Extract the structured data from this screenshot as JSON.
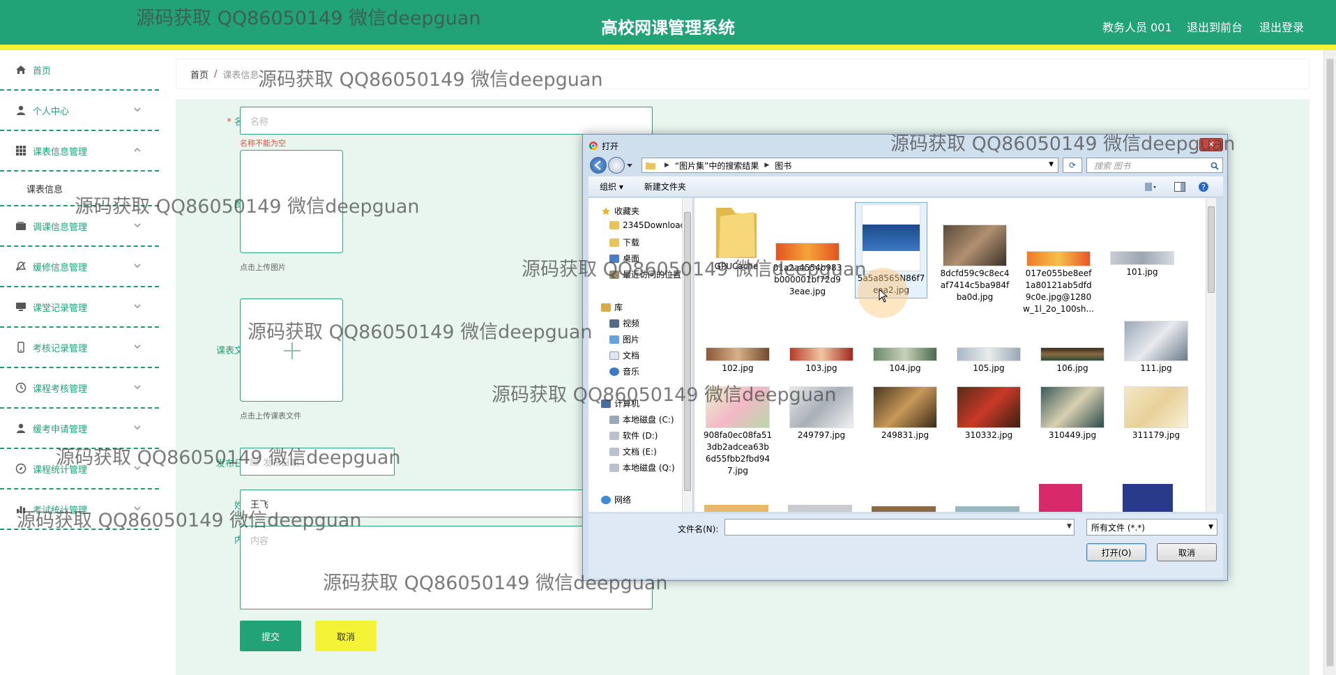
{
  "header": {
    "title": "高校网课管理系统",
    "user": "教务人员 001",
    "front_link": "退出到前台",
    "logout_link": "退出登录",
    "color": "#22a277",
    "accent": "#f5f335"
  },
  "sidebar": {
    "items": [
      {
        "label": "首页",
        "icon": "home-icon"
      },
      {
        "label": "个人中心",
        "icon": "user-icon"
      },
      {
        "label": "课表信息管理",
        "icon": "grid-icon"
      },
      {
        "label": "调课信息管理",
        "icon": "wallet-icon"
      },
      {
        "label": "缓修信息管理",
        "icon": "bell-off-icon"
      },
      {
        "label": "课堂记录管理",
        "icon": "monitor-icon"
      },
      {
        "label": "考核记录管理",
        "icon": "phone-icon"
      },
      {
        "label": "课程考核管理",
        "icon": "clock-icon"
      },
      {
        "label": "缓考申请管理",
        "icon": "user-icon"
      },
      {
        "label": "课程统计管理",
        "icon": "compass-icon"
      },
      {
        "label": "考试统计管理",
        "icon": "chart-icon"
      }
    ],
    "sub_item": "课表信息"
  },
  "breadcrumb": {
    "home": "首页",
    "sep": "/",
    "current": "课表信息"
  },
  "form": {
    "name_label": "名称",
    "name_placeholder": "名称",
    "name_error": "名称不能为空",
    "image_label": "图片",
    "image_hint": "点击上传图片",
    "file_label": "课表文件",
    "file_hint": "点击上传课表文件",
    "date_label": "发布日期",
    "date_placeholder": "发布日期",
    "teacher_label": "姓名",
    "teacher_value": "王飞",
    "content_label": "内容",
    "content_placeholder": "内容",
    "submit": "提交",
    "cancel": "取消"
  },
  "dialog": {
    "title": "打开",
    "close": "✕",
    "path": [
      "“图片集”中的搜索结果",
      "图书"
    ],
    "search_placeholder": "搜索 图书",
    "toolbar": {
      "organize": "组织 ▾",
      "new_folder": "新建文件夹"
    },
    "nav": {
      "favorites": "收藏夹",
      "favorites_items": [
        "2345Downloads",
        "下载",
        "桌面",
        "最近访问的位置"
      ],
      "libraries": "库",
      "library_items": [
        "视频",
        "图片",
        "文档",
        "音乐"
      ],
      "computer": "计算机",
      "drives": [
        "本地磁盘 (C:)",
        "软件 (D:)",
        "文档 (E:)",
        "本地磁盘 (Q:)"
      ],
      "network": "网络"
    },
    "files": [
      {
        "name": "GPUCache",
        "lines": [
          "GPUCache"
        ]
      },
      {
        "name": "01a2a4554b983b000001bf72d93eae.jpg",
        "lines": [
          "01a2a4554b983",
          "b000001bf72d9",
          "3eae.jpg"
        ]
      },
      {
        "name": "5a5a8565N86f7eaa2.jpg",
        "lines": [
          "5a5a8565N86f7",
          "eaa2.jpg"
        ]
      },
      {
        "name": "8dcfd59c9c8ec4af7414c5ba984fba0d.jpg",
        "lines": [
          "8dcfd59c9c8ec4",
          "af7414c5ba984f",
          "ba0d.jpg"
        ]
      },
      {
        "name": "017e055be8eef1a80121ab5dfd9c0e.jpg@1280w_1l_2o_100sh...",
        "lines": [
          "017e055be8eef",
          "1a80121ab5dfd",
          "9c0e.jpg@1280",
          "w_1l_2o_100sh..."
        ]
      },
      {
        "name": "101.jpg",
        "lines": [
          "101.jpg"
        ]
      },
      {
        "name": "102.jpg",
        "lines": [
          "102.jpg"
        ]
      },
      {
        "name": "103.jpg",
        "lines": [
          "103.jpg"
        ]
      },
      {
        "name": "104.jpg",
        "lines": [
          "104.jpg"
        ]
      },
      {
        "name": "105.jpg",
        "lines": [
          "105.jpg"
        ]
      },
      {
        "name": "106.jpg",
        "lines": [
          "106.jpg"
        ]
      },
      {
        "name": "111.jpg",
        "lines": [
          "111.jpg"
        ]
      },
      {
        "name": "908fa0ec08fa513db2adcea63b6d55fbb2fbd947.jpg",
        "lines": [
          "908fa0ec08fa51",
          "3db2adcea63b",
          "6d55fbb2fbd94",
          "7.jpg"
        ]
      },
      {
        "name": "249797.jpg",
        "lines": [
          "249797.jpg"
        ]
      },
      {
        "name": "249831.jpg",
        "lines": [
          "249831.jpg"
        ]
      },
      {
        "name": "310332.jpg",
        "lines": [
          "310332.jpg"
        ]
      },
      {
        "name": "310449.jpg",
        "lines": [
          "310449.jpg"
        ]
      },
      {
        "name": "311179.jpg",
        "lines": [
          "311179.jpg"
        ]
      }
    ],
    "filename_label": "文件名(N):",
    "filename_value": "",
    "filetype": "所有文件 (*.*)",
    "open_button": "打开(O)",
    "cancel_button": "取消"
  },
  "watermark": "源码获取 QQ86050149 微信deepguan"
}
